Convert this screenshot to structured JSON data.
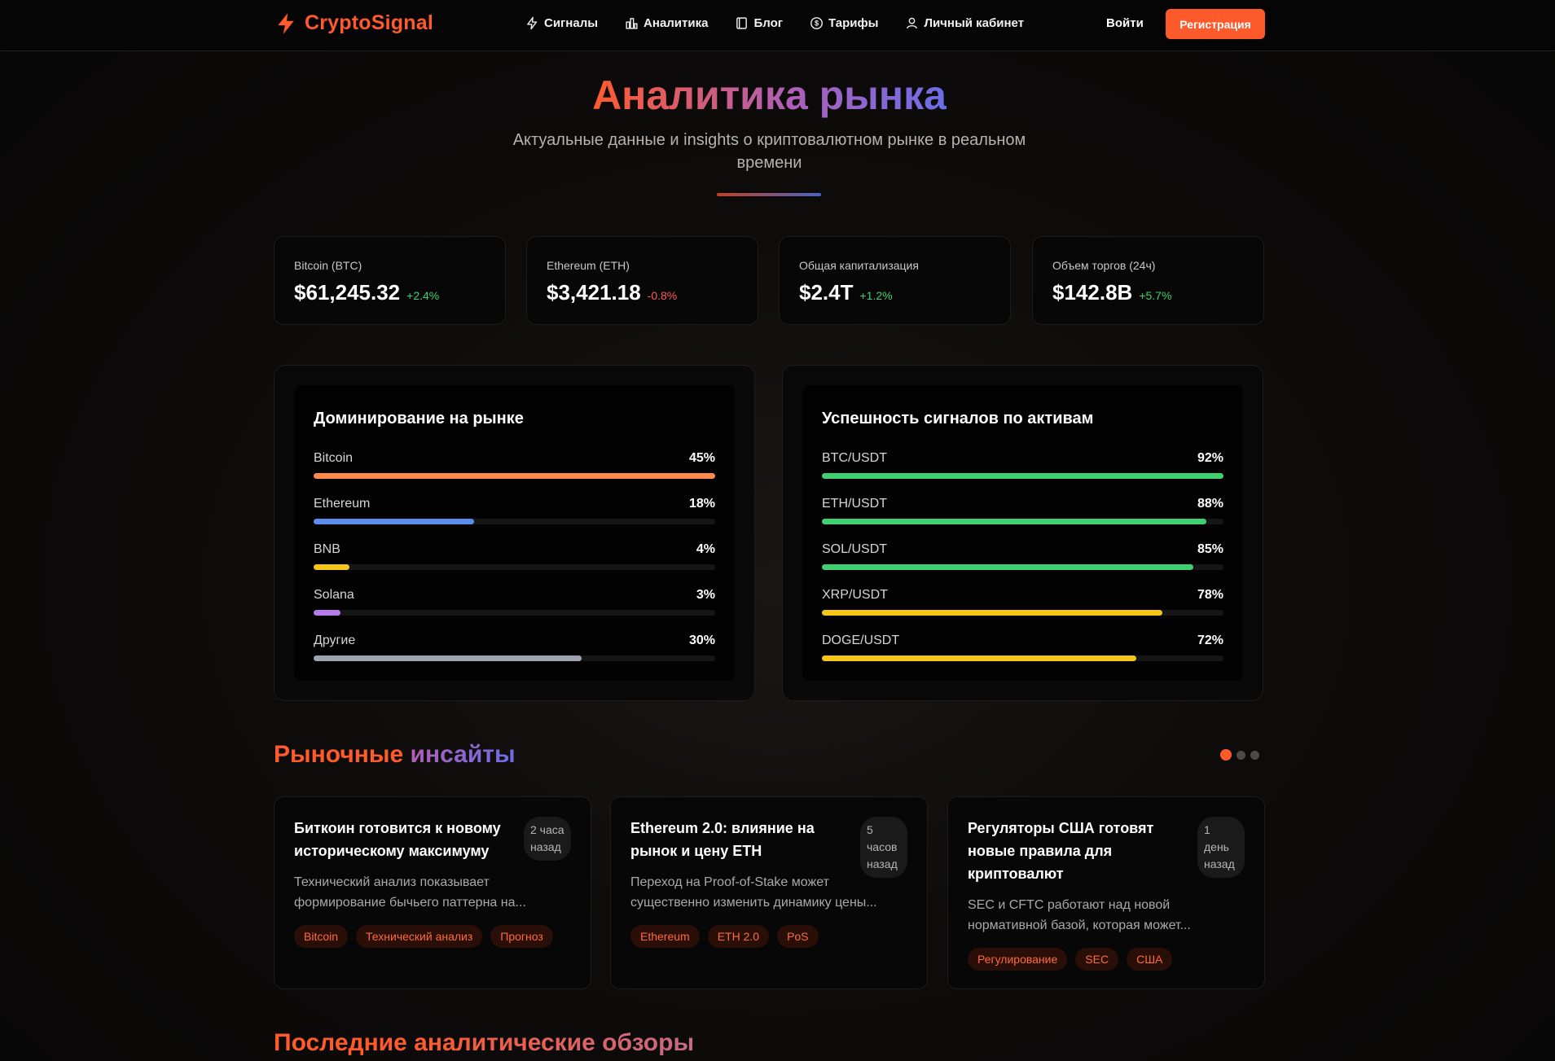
{
  "header": {
    "logo": "CryptoSignal",
    "nav": [
      {
        "label": "Сигналы",
        "icon": "lightning-icon"
      },
      {
        "label": "Аналитика",
        "icon": "bar-chart-icon"
      },
      {
        "label": "Блог",
        "icon": "book-icon"
      },
      {
        "label": "Тарифы",
        "icon": "dollar-icon"
      },
      {
        "label": "Личный кабинет",
        "icon": "user-icon"
      }
    ],
    "login": "Войти",
    "register": "Регистрация"
  },
  "hero": {
    "title": "Аналитика рынка",
    "subtitle": "Актуальные данные и insights о криптовалютном рынке в реальном времени"
  },
  "stats": [
    {
      "label": "Bitcoin (BTC)",
      "value": "$61,245.32",
      "change": "+2.4%",
      "trend": "up"
    },
    {
      "label": "Ethereum (ETH)",
      "value": "$3,421.18",
      "change": "-0.8%",
      "trend": "down"
    },
    {
      "label": "Общая капитализация",
      "value": "$2.4T",
      "change": "+1.2%",
      "trend": "up"
    },
    {
      "label": "Объем торгов (24ч)",
      "value": "$142.8B",
      "change": "+5.7%",
      "trend": "up"
    }
  ],
  "dominance": {
    "title": "Доминирование на рынке",
    "items": [
      {
        "label": "Bitcoin",
        "pct_label": "45%",
        "fill": 1.0,
        "color": "#ff8a4c"
      },
      {
        "label": "Ethereum",
        "pct_label": "18%",
        "fill": 0.4,
        "color": "#5b8def"
      },
      {
        "label": "BNB",
        "pct_label": "4%",
        "fill": 0.09,
        "color": "#f5c518"
      },
      {
        "label": "Solana",
        "pct_label": "3%",
        "fill": 0.067,
        "color": "#b57be8"
      },
      {
        "label": "Другие",
        "pct_label": "30%",
        "fill": 0.667,
        "color": "#9ca3af"
      }
    ]
  },
  "signals": {
    "title": "Успешность сигналов по активам",
    "items": [
      {
        "label": "BTC/USDT",
        "pct_label": "92%",
        "fill": 1.0,
        "color": "#3fd16f"
      },
      {
        "label": "ETH/USDT",
        "pct_label": "88%",
        "fill": 0.957,
        "color": "#3fd16f"
      },
      {
        "label": "SOL/USDT",
        "pct_label": "85%",
        "fill": 0.924,
        "color": "#3fd16f"
      },
      {
        "label": "XRP/USDT",
        "pct_label": "78%",
        "fill": 0.848,
        "color": "#f5c518"
      },
      {
        "label": "DOGE/USDT",
        "pct_label": "72%",
        "fill": 0.783,
        "color": "#f5c518"
      }
    ]
  },
  "insights": {
    "title_a": "Рыночные",
    "title_b": "инсайты",
    "cards": [
      {
        "title": "Биткоин готовится к новому историческому максимуму",
        "time": "2 часа назад",
        "text": "Технический анализ показывает формирование бычьего паттерна на...",
        "tags": [
          "Bitcoin",
          "Технический анализ",
          "Прогноз"
        ]
      },
      {
        "title": "Ethereum 2.0: влияние на рынок и цену ETH",
        "time": "5 часов назад",
        "text": "Переход на Proof-of-Stake может существенно изменить динамику цены...",
        "tags": [
          "Ethereum",
          "ETH 2.0",
          "PoS"
        ]
      },
      {
        "title": "Регуляторы США готовят новые правила для криптовалют",
        "time": "1 день назад",
        "text": "SEC и CFTC работают над новой нормативной базой, которая может...",
        "tags": [
          "Регулирование",
          "SEC",
          "США"
        ]
      }
    ]
  },
  "reviews": {
    "title_a": "Последние",
    "title_b": "аналитические обзоры"
  },
  "colors": {
    "accent": "#ff5a2c",
    "up": "#3fd16f",
    "down": "#ff5a5a"
  }
}
